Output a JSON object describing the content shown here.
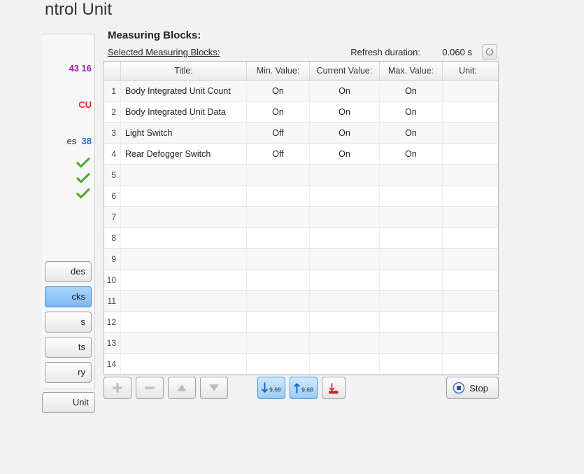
{
  "window": {
    "title_fragment": "ntrol Unit"
  },
  "left": {
    "value1_fragment": "43 16",
    "value2_fragment": "CU",
    "value3_label_fragment": "es",
    "value3_value": "38",
    "buttons": {
      "b1": "des",
      "b2": "cks",
      "b3": "s",
      "b4": "ts",
      "b5": "ry",
      "foot": "Unit"
    }
  },
  "main": {
    "heading": "Measuring Blocks:",
    "selected_label": "Selected Measuring Blocks:",
    "refresh_label": "Refresh duration:",
    "refresh_value": "0.060 s",
    "columns": {
      "idx": "",
      "title": "Title:",
      "min": "Min. Value:",
      "cur": "Current Value:",
      "max": "Max. Value:",
      "unit": "Unit:"
    },
    "rows": [
      {
        "idx": "1",
        "title": "Body Integrated Unit Count",
        "min": "On",
        "cur": "On",
        "max": "On",
        "unit": ""
      },
      {
        "idx": "2",
        "title": "Body Integrated Unit Data",
        "min": "On",
        "cur": "On",
        "max": "On",
        "unit": ""
      },
      {
        "idx": "3",
        "title": "Light Switch",
        "min": "Off",
        "cur": "On",
        "max": "On",
        "unit": ""
      },
      {
        "idx": "4",
        "title": "Rear Defogger Switch",
        "min": "Off",
        "cur": "On",
        "max": "On",
        "unit": ""
      },
      {
        "idx": "5",
        "title": "",
        "min": "",
        "cur": "",
        "max": "",
        "unit": ""
      },
      {
        "idx": "6",
        "title": "",
        "min": "",
        "cur": "",
        "max": "",
        "unit": ""
      },
      {
        "idx": "7",
        "title": "",
        "min": "",
        "cur": "",
        "max": "",
        "unit": ""
      },
      {
        "idx": "8",
        "title": "",
        "min": "",
        "cur": "",
        "max": "",
        "unit": ""
      },
      {
        "idx": "9",
        "title": "",
        "min": "",
        "cur": "",
        "max": "",
        "unit": ""
      },
      {
        "idx": "10",
        "title": "",
        "min": "",
        "cur": "",
        "max": "",
        "unit": ""
      },
      {
        "idx": "11",
        "title": "",
        "min": "",
        "cur": "",
        "max": "",
        "unit": ""
      },
      {
        "idx": "12",
        "title": "",
        "min": "",
        "cur": "",
        "max": "",
        "unit": ""
      },
      {
        "idx": "13",
        "title": "",
        "min": "",
        "cur": "",
        "max": "",
        "unit": ""
      },
      {
        "idx": "14",
        "title": "",
        "min": "",
        "cur": "",
        "max": "",
        "unit": ""
      }
    ]
  },
  "toolbar": {
    "mid_label_a": "9,68",
    "mid_label_b": "9,68",
    "stop_label": "Stop"
  }
}
